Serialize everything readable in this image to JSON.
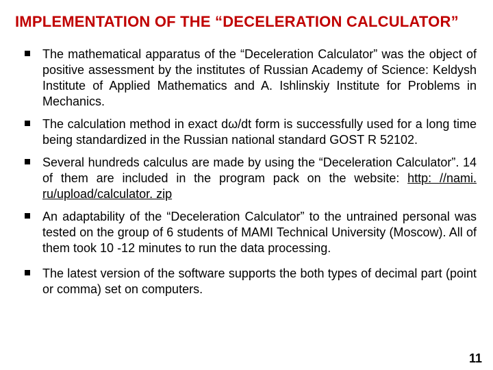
{
  "title": "IMPLEMENTATION OF THE “DECELERATION CALCULATOR”",
  "bullets": [
    {
      "text": "The mathematical apparatus of the “Deceleration Calculator” was the object of positive assessment by the institutes of Russian Academy of Science:  Keldysh Institute of Applied Mathematics and A. Ishlinskiy Institute for Problems in Mechanics."
    },
    {
      "text": "The calculation method in exact dω/dt form is successfully used for a long time being standardized in the Russian national standard GOST R 52102."
    },
    {
      "text_before_link": "Several hundreds calculus are made by using the “Deceleration Calculator”. 14 of  them are included in the program pack on the website: ",
      "link_text": "http: //nami. ru/upload/calculator. zip"
    },
    {
      "text": "An adaptability of the “Deceleration Calculator” to the untrained personal was tested on the group of 6 students of MAMI Technical University (Moscow). All of them took 10 -12 minutes to run the data processing."
    },
    {
      "text": "The latest version of the software supports the both types of decimal part (point or comma) set on computers."
    }
  ],
  "page_number": "11"
}
